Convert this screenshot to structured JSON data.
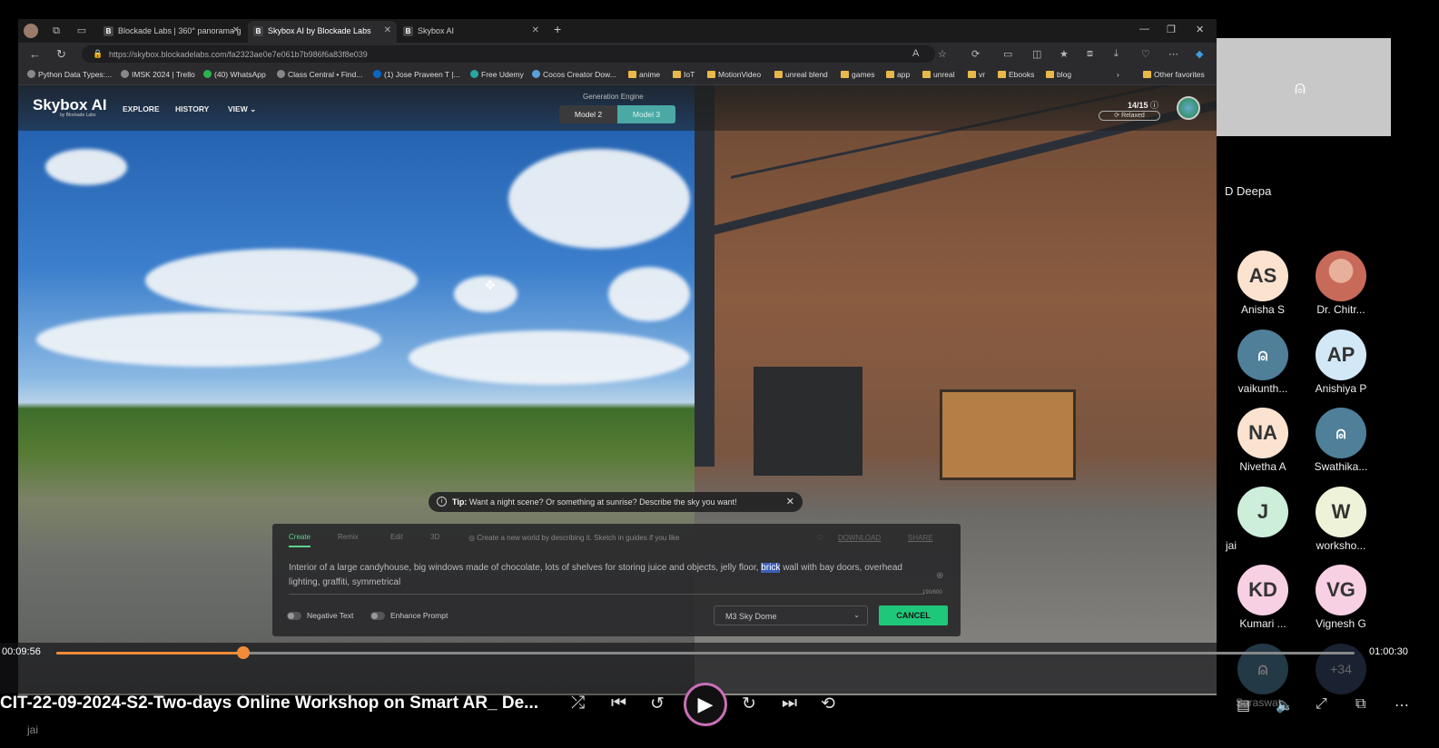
{
  "browser": {
    "tabs": [
      {
        "label": "Blockade Labs | 360° panorama g",
        "favicon": "B"
      },
      {
        "label": "Skybox AI by Blockade Labs",
        "favicon": "B"
      },
      {
        "label": "Skybox AI",
        "favicon": "B"
      }
    ],
    "new_tab": "+",
    "url": "https://skybox.blockadelabs.com/fa2323ae0e7e061b7b986f6a83f8e039",
    "bookmarks": [
      "Python Data Types:...",
      "IMSK 2024 | Trello",
      "(40) WhatsApp",
      "Class Central • Find...",
      "(1) Jose Praveen T |...",
      "Free Udemy",
      "Cocos Creator Dow...",
      "anime",
      "IoT",
      "MotionVideo",
      "unreal blend",
      "games",
      "app",
      "unreal",
      "vr",
      "Ebooks",
      "blog"
    ],
    "other_favorites": "Other favorites"
  },
  "skybox": {
    "logo": "Skybox AI",
    "logo_sub": "by Blockade Labs",
    "nav": [
      "EXPLORE",
      "HISTORY",
      "VIEW"
    ],
    "engine_label": "Generation Engine",
    "models": [
      "Model 2",
      "Model 3"
    ],
    "credits": "14/15",
    "mode": "Relaxed",
    "tip_bold": "Tip:",
    "tip_text": "Want a night scene? Or something at sunrise? Describe the sky you want!",
    "panel_tabs": [
      "Create",
      "Remix",
      "Edit",
      "3D"
    ],
    "panel_hint": "Create a new world by describing it. Sketch in guides if you like",
    "download": "DOWNLOAD",
    "share": "SHARE",
    "prompt_before": "Interior of a large candyhouse, big windows made of chocolate, lots of shelves for storing juice and objects, jelly floor, ",
    "prompt_highlight": "brick",
    "prompt_after": " wall with bay doors, overhead lighting, graffiti, symmetrical",
    "char_count": "190/600",
    "negative_text": "Negative Text",
    "enhance_prompt": "Enhance Prompt",
    "style_select": "M3 Sky Dome",
    "cancel": "CANCEL"
  },
  "meeting": {
    "speaker": "D Deepa",
    "participants": [
      {
        "initials": "AS",
        "name": "Anisha S",
        "color": "#fbe3d0"
      },
      {
        "initials": "",
        "name": "Dr. Chitr...",
        "color": "#c86a5a"
      },
      {
        "initials": "",
        "name": "vaikunth...",
        "color": "#4f7f99"
      },
      {
        "initials": "AP",
        "name": "Anishiya P",
        "color": "#d3e8f7"
      },
      {
        "initials": "NA",
        "name": "Nivetha A",
        "color": "#fbe3d0"
      },
      {
        "initials": "",
        "name": "Swathika...",
        "color": "#4f7f99"
      },
      {
        "initials": "J",
        "name": "jai",
        "color": "#cdeed8"
      },
      {
        "initials": "W",
        "name": "worksho...",
        "color": "#eef2d8"
      },
      {
        "initials": "KD",
        "name": "Kumari ...",
        "color": "#f8d0e4"
      },
      {
        "initials": "VG",
        "name": "Vignesh G",
        "color": "#f8d0e4"
      },
      {
        "initials": "",
        "name": "Saraswat...",
        "color": "#4f7f99"
      },
      {
        "initials": "+34",
        "name": "",
        "color": "#3a4a6a"
      }
    ]
  },
  "player": {
    "elapsed": "00:09:56",
    "total": "01:00:30",
    "progress": 0.1443,
    "title": "CIT-22-09-2024-S2-Two-days Online Workshop on Smart AR_ De...",
    "subtitle": "jai"
  }
}
